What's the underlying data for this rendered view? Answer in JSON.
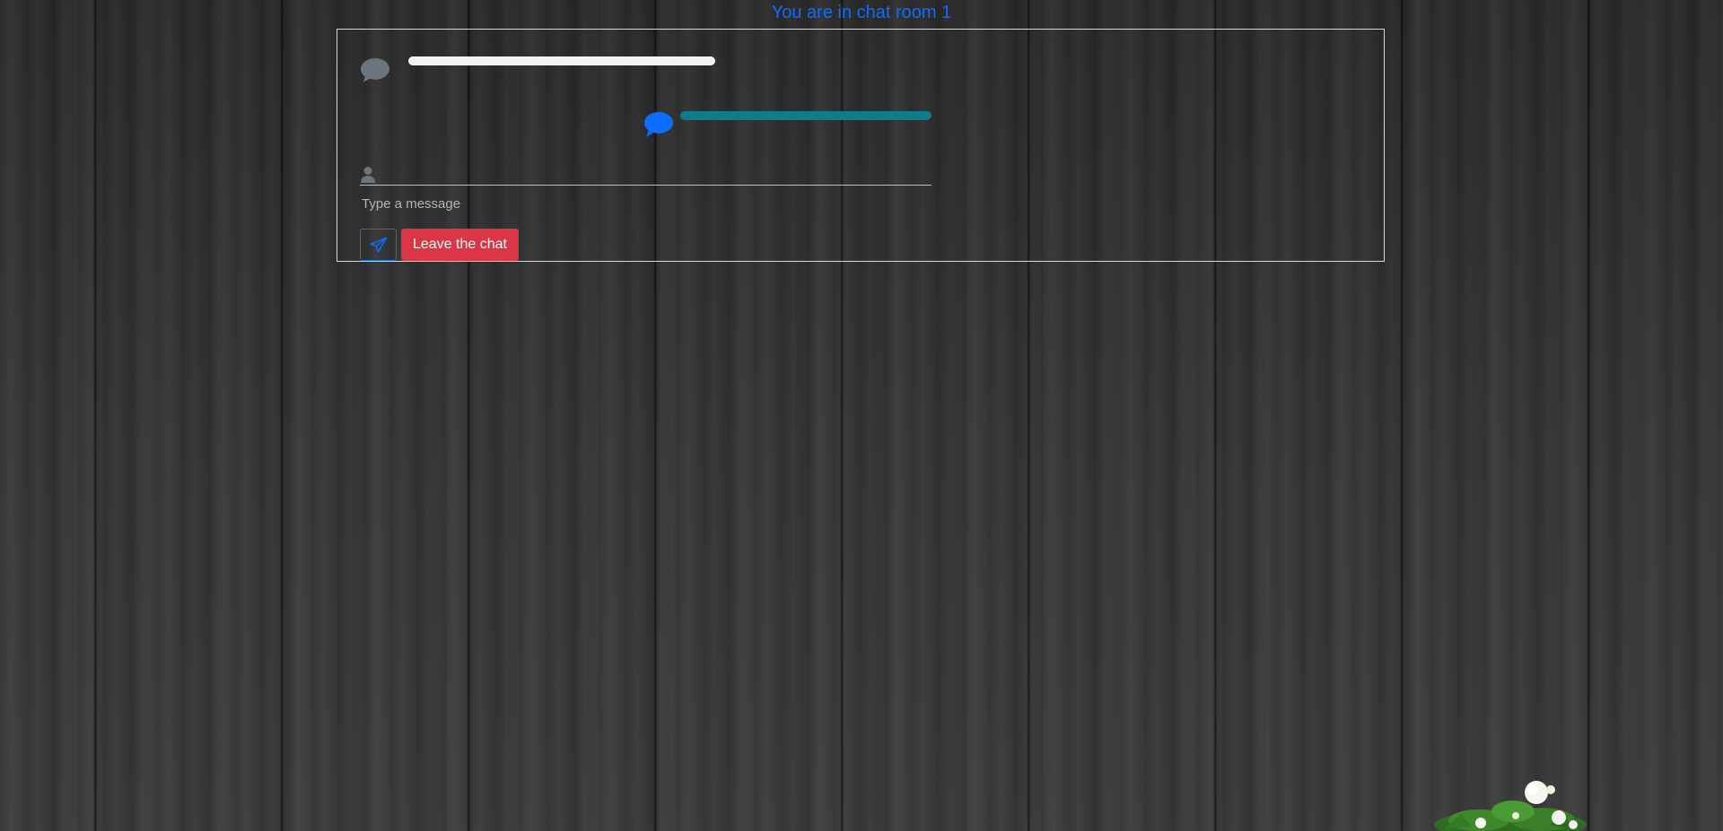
{
  "room": {
    "title": "You are in chat room 1"
  },
  "composer": {
    "placeholder": "Type a message",
    "send_icon": "paper-plane-icon",
    "leave_label": "Leave the chat"
  },
  "icons": {
    "incoming_message": "chat-bubble-icon",
    "outgoing_message": "chat-bubble-icon",
    "user": "user-icon"
  },
  "colors": {
    "accent": "#0d6efd",
    "danger": "#dc3545",
    "incoming_icon": "#6c757d",
    "incoming_text_bar": "#f2f2f2",
    "outgoing_text_bar": "#117a8b"
  }
}
